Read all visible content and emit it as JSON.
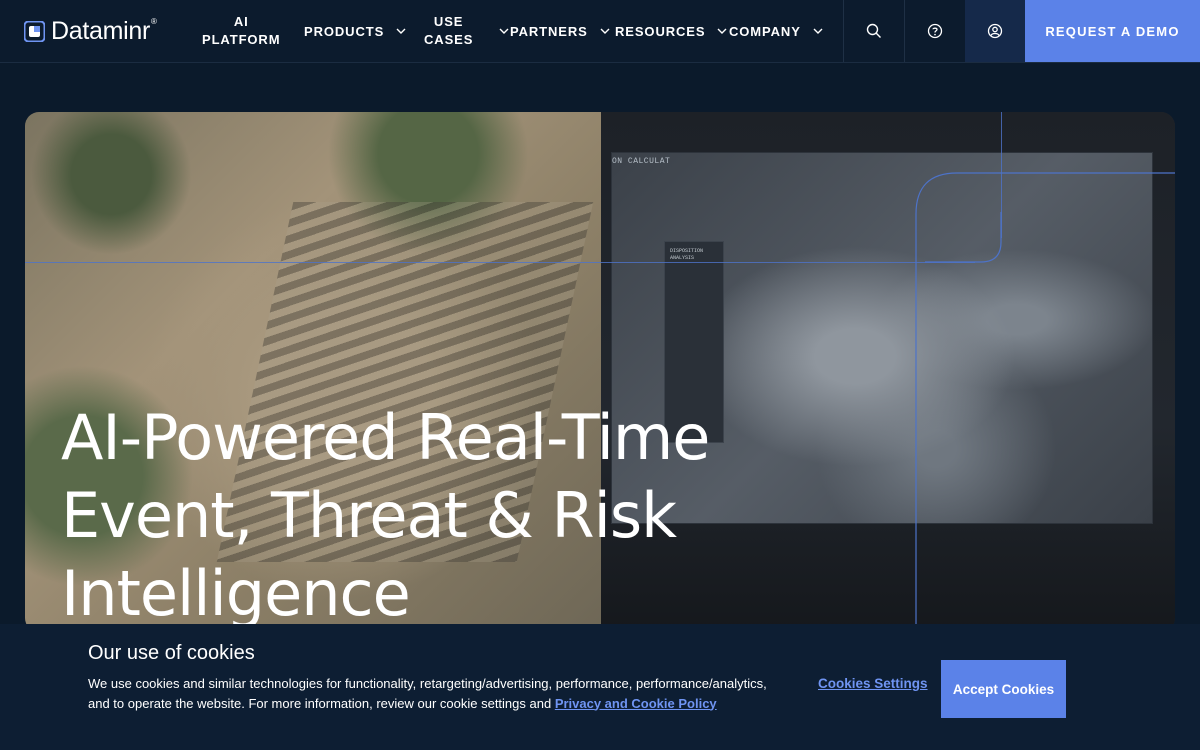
{
  "nav": {
    "logo_text": "Dataminr",
    "logo_reg": "®",
    "items": [
      {
        "line1": "AI",
        "line2": "PLATFORM",
        "has_chevron": false
      },
      {
        "line1": "PRODUCTS",
        "line2": "",
        "has_chevron": true
      },
      {
        "line1": "USE",
        "line2": "CASES",
        "has_chevron": true
      },
      {
        "line1": "PARTNERS",
        "line2": "",
        "has_chevron": true
      },
      {
        "line1": "RESOURCES",
        "line2": "",
        "has_chevron": true
      },
      {
        "line1": "COMPANY",
        "line2": "",
        "has_chevron": true
      }
    ],
    "icons": [
      "search-icon",
      "help-icon",
      "user-icon"
    ],
    "demo_label": "REQUEST A DEMO"
  },
  "hero": {
    "title_line1": "AI-Powered Real-Time",
    "title_line2": "Event, Threat & Risk",
    "title_line3": "Intelligence",
    "screen_label": "ON CALCULAT",
    "panel_title_1": "DISPOSITION",
    "panel_title_2": "ANALYSIS"
  },
  "cookies": {
    "title": "Our use of cookies",
    "text": "We use cookies and similar technologies for functionality, retargeting/advertising, performance, performance/analytics, and to operate the website. For more information, review our cookie settings and ",
    "policy_link": "Privacy and Cookie Policy",
    "settings_label": "Cookies Settings",
    "accept_label": "Accept Cookies"
  },
  "colors": {
    "background": "#0b1a2b",
    "accent": "#5b82e8",
    "link": "#6f94f2"
  }
}
